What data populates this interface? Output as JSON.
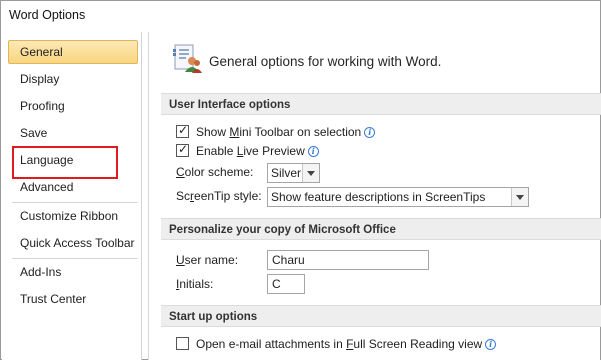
{
  "window": {
    "title": "Word Options"
  },
  "sidebar": {
    "items": [
      {
        "label": "General",
        "selected": true
      },
      {
        "label": "Display"
      },
      {
        "label": "Proofing"
      },
      {
        "label": "Save"
      },
      {
        "label": "Language"
      },
      {
        "label": "Advanced"
      },
      {
        "label": "Customize Ribbon"
      },
      {
        "label": "Quick Access Toolbar"
      },
      {
        "label": "Add-Ins"
      },
      {
        "label": "Trust Center"
      }
    ]
  },
  "main": {
    "header": "General options for working with Word.",
    "ui_options": {
      "title": "User Interface options",
      "mini_toolbar": {
        "pre": "Show ",
        "acc": "M",
        "post": "ini Toolbar on selection",
        "checked": true
      },
      "live_preview": {
        "pre": "Enable ",
        "acc": "L",
        "post": "ive Preview",
        "checked": true
      },
      "color_scheme": {
        "label_acc": "C",
        "label_post": "olor scheme:",
        "value": "Silver"
      },
      "screentip": {
        "label_pre": "Sc",
        "label_acc": "r",
        "label_post": "eenTip style:",
        "value": "Show feature descriptions in ScreenTips"
      }
    },
    "personalize": {
      "title": "Personalize your copy of Microsoft Office",
      "user_name": {
        "label_acc": "U",
        "label_post": "ser name:",
        "value": "Charu"
      },
      "initials": {
        "label_acc": "I",
        "label_post": "nitials:",
        "value": "C"
      }
    },
    "startup": {
      "title": "Start up options",
      "email_attach": {
        "pre": "Open e-mail attachments in ",
        "acc": "F",
        "post": "ull Screen Reading view",
        "checked": false
      }
    }
  },
  "icons": {
    "info": "info-icon",
    "options": "general-options-icon"
  },
  "colors": {
    "selected_bg": "#f8d57f",
    "highlight": "#e01b1b",
    "section_bg": "#eeeeee"
  }
}
